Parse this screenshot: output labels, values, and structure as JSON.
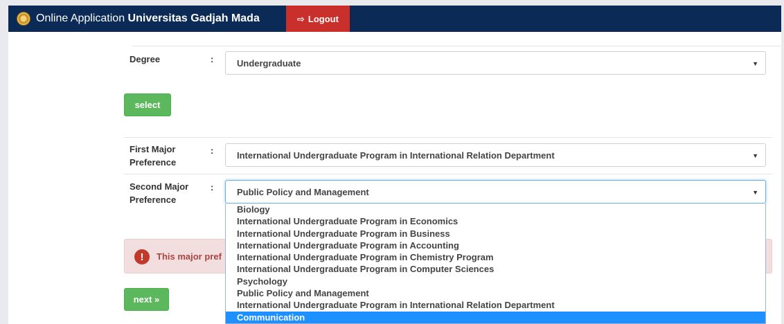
{
  "header": {
    "title_prefix": "Online Application",
    "title_university": "Universitas Gadjah Mada",
    "logout_label": "Logout",
    "logout_icon": "sign-out-icon",
    "colors": {
      "navbar": "#0b2a55",
      "logout": "#c9302c"
    }
  },
  "form": {
    "degree": {
      "label": "Degree",
      "colon": ":",
      "value": "Undergraduate"
    },
    "select_button": "select",
    "first_major": {
      "label_line1": "First Major",
      "label_line2": "Preference",
      "colon": ":",
      "value": "International Undergraduate Program in International Relation Department"
    },
    "second_major": {
      "label_line1": "Second Major",
      "label_line2": "Preference",
      "colon": ":",
      "value": "Public Policy and Management"
    },
    "alert_text": "This major pref",
    "next_button": "next »",
    "colors": {
      "button": "#5cb85c",
      "alert_bg": "#f2dede",
      "alert_text": "#a94442",
      "selected_option": "#1e90ff"
    }
  },
  "dropdown": {
    "options": [
      "Biology",
      "International Undergraduate Program in Economics",
      "International Undergraduate Program in Business",
      "International Undergraduate Program in Accounting",
      "International Undergraduate Program in Chemistry Program",
      "International Undergraduate Program in Computer Sciences",
      "Psychology",
      "Public Policy and Management",
      "International Undergraduate Program in International Relation Department",
      "Communication"
    ],
    "highlighted": "Communication"
  }
}
